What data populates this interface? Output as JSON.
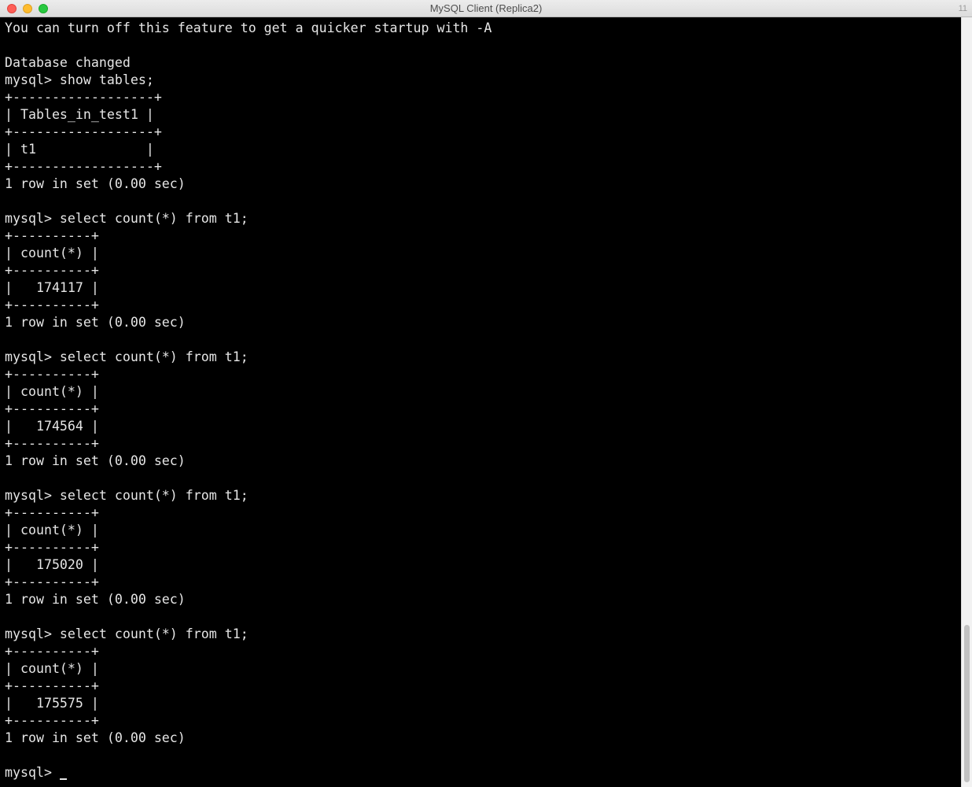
{
  "window": {
    "title": "MySQL Client (Replica2)",
    "corner_number": "11"
  },
  "terminal": {
    "lines": [
      "You can turn off this feature to get a quicker startup with -A",
      "",
      "Database changed",
      "mysql> show tables;",
      "+------------------+",
      "| Tables_in_test1 |",
      "+------------------+",
      "| t1              |",
      "+------------------+",
      "1 row in set (0.00 sec)",
      "",
      "mysql> select count(*) from t1;",
      "+----------+",
      "| count(*) |",
      "+----------+",
      "|   174117 |",
      "+----------+",
      "1 row in set (0.00 sec)",
      "",
      "mysql> select count(*) from t1;",
      "+----------+",
      "| count(*) |",
      "+----------+",
      "|   174564 |",
      "+----------+",
      "1 row in set (0.00 sec)",
      "",
      "mysql> select count(*) from t1;",
      "+----------+",
      "| count(*) |",
      "+----------+",
      "|   175020 |",
      "+----------+",
      "1 row in set (0.00 sec)",
      "",
      "mysql> select count(*) from t1;",
      "+----------+",
      "| count(*) |",
      "+----------+",
      "|   175575 |",
      "+----------+",
      "1 row in set (0.00 sec)",
      ""
    ],
    "prompt": "mysql> "
  },
  "colors": {
    "background": "#000000",
    "text": "#e6e6e6",
    "close": "#fe5f57",
    "minimize": "#febc2e",
    "maximize": "#28c840"
  }
}
